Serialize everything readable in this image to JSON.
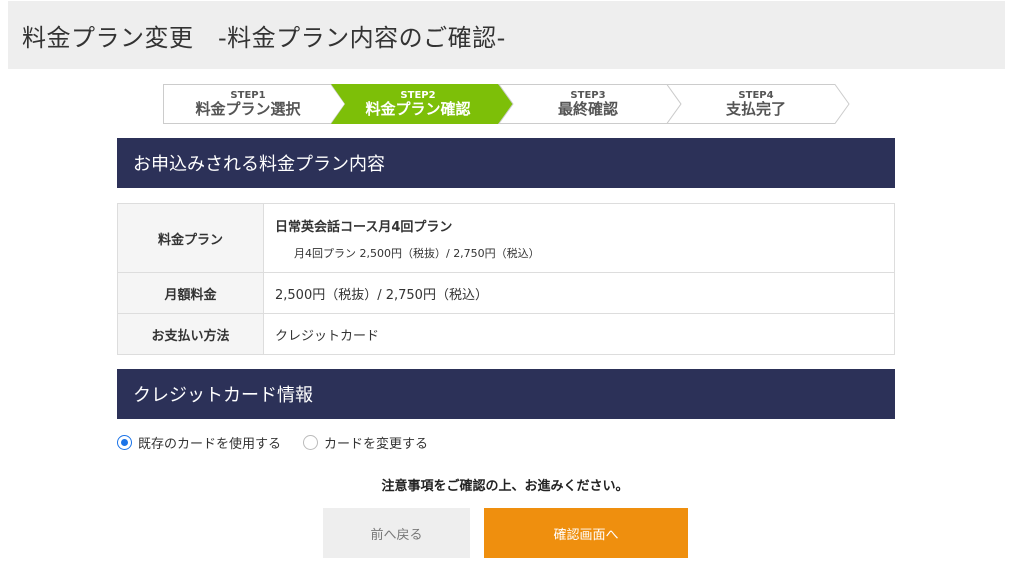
{
  "header": {
    "title": "料金プラン変更　-料金プラン内容のご確認-"
  },
  "steps": [
    {
      "num": "STEP1",
      "name": "料金プラン選択"
    },
    {
      "num": "STEP2",
      "name": "料金プラン確認"
    },
    {
      "num": "STEP3",
      "name": "最終確認"
    },
    {
      "num": "STEP4",
      "name": "支払完了"
    }
  ],
  "colors": {
    "active_step": "#7dbf08",
    "section_bar": "#2c3158",
    "next_button": "#ef8f0e",
    "radio_accent": "#1a73e8"
  },
  "plan_section": {
    "title": "お申込みされる料金プラン内容",
    "rows": {
      "plan": {
        "label": "料金プラン",
        "name": "日常英会話コース月4回プラン",
        "detail": "月4回プラン 2,500円（税抜）/ 2,750円（税込）"
      },
      "fee": {
        "label": "月額料金",
        "value": "2,500円（税抜）/ 2,750円（税込）"
      },
      "payment": {
        "label": "お支払い方法",
        "value": "クレジットカード"
      }
    }
  },
  "card_section": {
    "title": "クレジットカード情報",
    "options": [
      {
        "label": "既存のカードを使用する",
        "selected": true
      },
      {
        "label": "カードを変更する",
        "selected": false
      }
    ]
  },
  "notice": "注意事項をご確認の上、お進みください。",
  "buttons": {
    "back": "前へ戻る",
    "next": "確認画面へ"
  }
}
